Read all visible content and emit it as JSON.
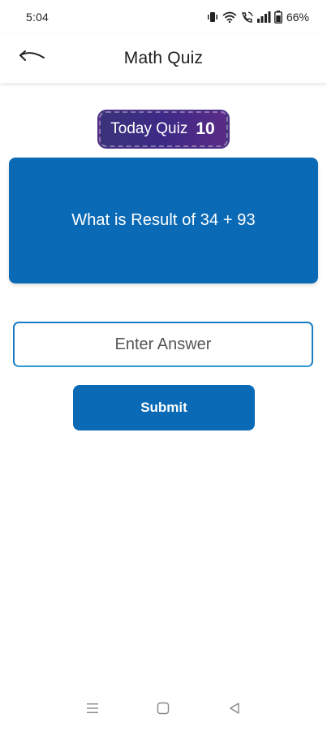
{
  "status_bar": {
    "time": "5:04",
    "battery": "66%",
    "icons": [
      "vibrate-icon",
      "wifi-icon",
      "wifi-calling-icon",
      "signal-icon",
      "battery-icon"
    ]
  },
  "app_bar": {
    "title": "Math Quiz",
    "back_icon": "back-arrow-icon"
  },
  "badge": {
    "label": "Today Quiz",
    "count": "10"
  },
  "question": {
    "text": "What is Result of 34 + 93"
  },
  "answer": {
    "value": "",
    "placeholder": "Enter Answer"
  },
  "submit": {
    "label": "Submit"
  },
  "nav_bar": {
    "icons": [
      "menu-icon",
      "home-square-icon",
      "back-triangle-icon"
    ]
  },
  "colors": {
    "primary": "#0a6ab5",
    "badge_start": "#39337a",
    "badge_end": "#5a2b86",
    "input_border": "#1a7cc2"
  }
}
